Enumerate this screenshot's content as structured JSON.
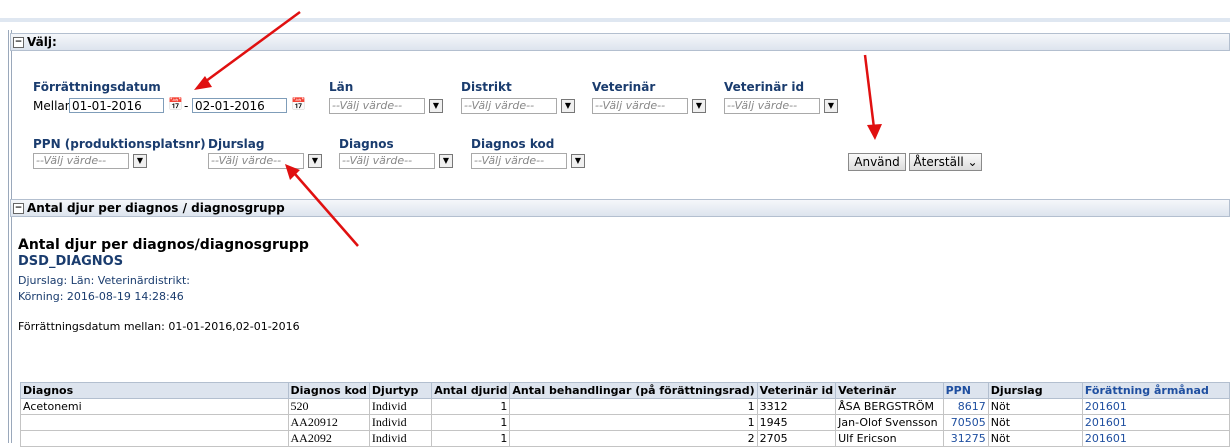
{
  "filters_panel": {
    "title": "Välj:",
    "forrattningsdatum_label": "Förrättningsdatum",
    "between_label": "Mellan",
    "date_from": "01-01-2016",
    "date_sep": "-",
    "date_to": "02-01-2016",
    "lan_label": "Län",
    "distrikt_label": "Distrikt",
    "veterinar_label": "Veterinär",
    "veterinar_id_label": "Veterinär id",
    "ppn_label": "PPN (produktionsplatsnr)",
    "djurslag_label": "Djurslag",
    "diagnos_label": "Diagnos",
    "diagnos_kod_label": "Diagnos kod",
    "select_placeholder": "--Välj värde--",
    "apply_button": "Använd",
    "reset_button": "Återställ"
  },
  "report_panel": {
    "title": "Antal djur per diagnos / diagnosgrupp",
    "report_title": "Antal djur per diagnos/diagnosgrupp",
    "report_code": "DSD_DIAGNOS",
    "params_line": "Djurslag: Län: Veterinärdistrikt:",
    "run_line": "Körning: 2016-08-19 14:28:46",
    "filter_line": "Förrättningsdatum mellan: 01-01-2016,02-01-2016"
  },
  "table": {
    "headers": [
      "Diagnos",
      "Diagnos kod",
      "Djurtyp",
      "Antal djurid",
      "Antal behandlingar (på förättningsrad)",
      "Veterinär id",
      "Veterinär",
      "PPN",
      "Djurslag",
      "Förättning årmånad"
    ],
    "rows": [
      [
        "Acetonemi",
        "520",
        "Individ",
        "1",
        "1",
        "3312",
        "ÅSA BERGSTRÖM",
        "8617",
        "Nöt",
        "201601"
      ],
      [
        "",
        "AA20912",
        "Individ",
        "1",
        "1",
        "1945",
        "Jan-Olof Svensson",
        "70505",
        "Nöt",
        "201601"
      ],
      [
        "",
        "AA2092",
        "Individ",
        "1",
        "2",
        "2705",
        "Ulf Ericson",
        "31275",
        "Nöt",
        "201601"
      ]
    ]
  },
  "colors": {
    "annotation_arrow": "#e01010",
    "label_blue": "#1a3c6e",
    "header_bg": "#dde4ee"
  }
}
